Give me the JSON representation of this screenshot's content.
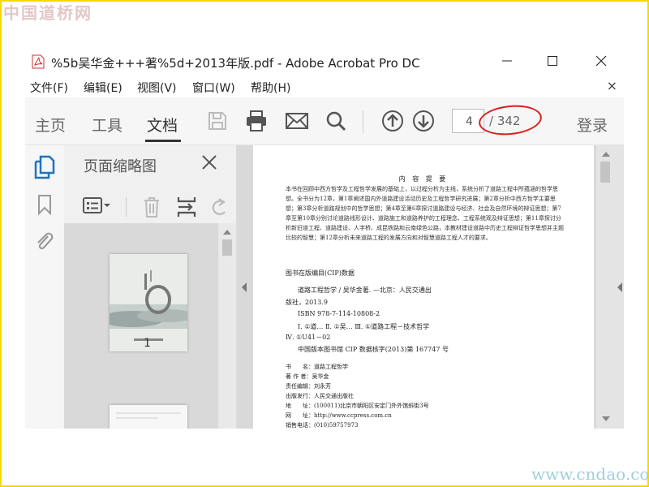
{
  "watermark_top": "中国道桥网",
  "watermark_bottom": "www.cndao.com",
  "window": {
    "title": "%5b吴华金+++著%5d+2013年版.pdf - Adobe Acrobat Pro DC",
    "controls": {
      "minimize": "minimize-icon",
      "maximize": "maximize-icon",
      "close": "close-icon"
    }
  },
  "menu": [
    "文件(F)",
    "编辑(E)",
    "视图(V)",
    "窗口(W)",
    "帮助(H)"
  ],
  "menu_close": "×",
  "toolbar": {
    "tabs": [
      "主页",
      "工具",
      "文档"
    ],
    "active_tab": "文档",
    "page_current": "4",
    "page_total": "/ 342",
    "sign_in": "登录"
  },
  "panel": {
    "title": "页面缩略图",
    "thumbnail_label": "1"
  },
  "page": {
    "heading": "内 容 提 要",
    "summary": "本书在回顾中西方哲学及工程哲学发展的基础上，以过程分析为主线，系统分析了道路工程中所蕴涵的哲学思想。全书分为12章，第1章阐述国内外道路建设活动历史及工程哲学研究进展；第2章分析中西方哲学主要思想；第3章分析道路规划中的哲学思想；第4章至第6章探讨道路建设与经济、社会及自然环境的辩证思想；第7章至第10章分别讨论道路线形设计、道路施工和道路养护的工程理念、工程系统观及辩证思想；第11章探讨分析新旧道工程、道路建设、人字桥、成昆铁路和云南绿色公路，本教材建设道路中历史工程辩证哲学思想并主题比较的智慧；第12章分析未来道路工程的发展方向和对智慧道路工程人才的要求。",
    "cip_title": "图书在版编目(CIP)数据",
    "cip_line1": "道路工程哲学 / 吴华金著. —北京：人民交通出",
    "cip_line2": "版社，2013.9",
    "cip_isbn": "ISBN 978-7-114-10808-2",
    "cip_class": "Ⅰ. ①道…  Ⅱ. ①吴…  Ⅲ. ①道路工程－技术哲学",
    "cip_class2": "Ⅳ. ①U41－02",
    "cip_number": "中国版本图书馆 CIP 数据核字(2013)第 167747 号",
    "pub_rows": [
      "书　　名：道路工程哲学",
      "著 作 者：吴华金",
      "责任编辑：刘永芳",
      "出版发行：人民交通出版社",
      "地　　址：(100011)北京市朝阳区安定门外外馆斜街3号",
      "网　　址：http://www.ccpress.com.cn",
      "销售电话：(010)59757973"
    ]
  }
}
